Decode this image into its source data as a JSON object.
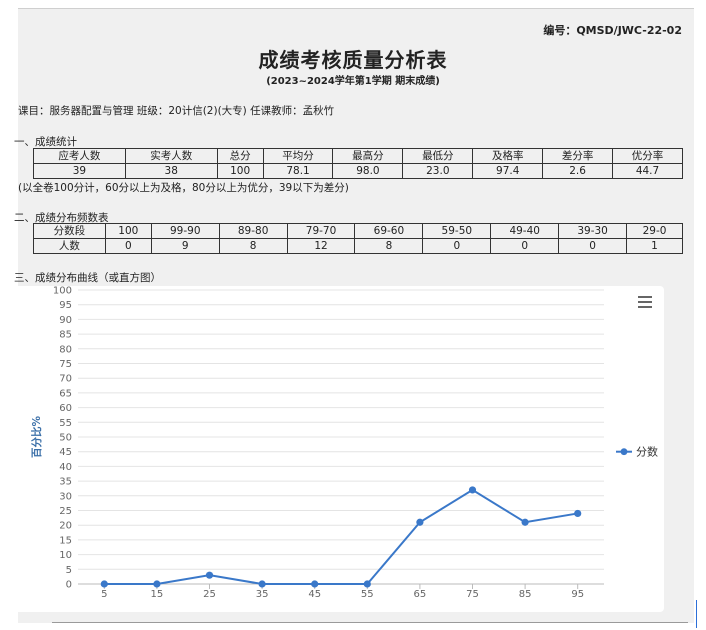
{
  "header": {
    "doc_no": "编号：QMSD/JWC-22-02",
    "title": "成绩考核质量分析表",
    "subtitle": "(2023~2024学年第1学期  期末成绩)",
    "course_line": "课目：服务器配置与管理  班级：20计信(2)(大专)  任课教师：孟秋竹"
  },
  "section1": {
    "heading": "一、成绩统计",
    "headers": [
      "应考人数",
      "实考人数",
      "总分",
      "平均分",
      "最高分",
      "最低分",
      "及格率",
      "差分率",
      "优分率"
    ],
    "values": [
      "39",
      "38",
      "100",
      "78.1",
      "98.0",
      "23.0",
      "97.4",
      "2.6",
      "44.7"
    ],
    "note": "(以全卷100分计，60分以上为及格，80分以上为优分，39以下为差分)"
  },
  "section2": {
    "heading": "二、成绩分布频数表",
    "headers": [
      "分数段",
      "100",
      "99-90",
      "89-80",
      "79-70",
      "69-60",
      "59-50",
      "49-40",
      "39-30",
      "29-0"
    ],
    "values": [
      "人数",
      "0",
      "9",
      "8",
      "12",
      "8",
      "0",
      "0",
      "0",
      "1"
    ]
  },
  "section3": {
    "heading": "三、成绩分布曲线（或直方图）"
  },
  "chart_data": {
    "type": "line",
    "x": [
      5,
      15,
      25,
      35,
      45,
      55,
      65,
      75,
      85,
      95
    ],
    "series": [
      {
        "name": "分数",
        "values": [
          0,
          0,
          3,
          0,
          0,
          0,
          21,
          32,
          21,
          24
        ]
      }
    ],
    "ylabel": "百分比%",
    "ylim": [
      0,
      100
    ],
    "yticks": [
      0,
      5,
      10,
      15,
      20,
      25,
      30,
      35,
      40,
      45,
      50,
      55,
      60,
      65,
      70,
      75,
      80,
      85,
      90,
      95,
      100
    ],
    "grid": true,
    "legend": "right",
    "series_color": "#3a78c9"
  }
}
